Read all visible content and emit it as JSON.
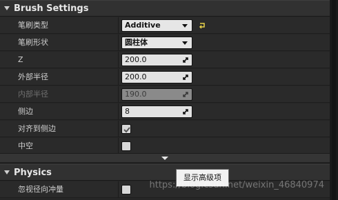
{
  "brush_settings": {
    "title": "Brush Settings",
    "brush_type": {
      "label": "笔刷类型",
      "value": "Additive"
    },
    "brush_shape": {
      "label": "笔刷形状",
      "value": "圆柱体"
    },
    "z": {
      "label": "Z",
      "value": "200.0"
    },
    "outer_radius": {
      "label": "外部半径",
      "value": "200.0"
    },
    "inner_radius": {
      "label": "内部半径",
      "value": "190.0"
    },
    "sides": {
      "label": "侧边",
      "value": "8"
    },
    "align_to_side": {
      "label": "对齐到侧边",
      "checked": true
    },
    "hollow": {
      "label": "中空",
      "checked": false
    }
  },
  "advanced_tooltip": "显示高级项",
  "physics": {
    "title": "Physics",
    "ignore_radial_impulse": {
      "label": "忽视径向冲量",
      "checked": false
    }
  },
  "watermark": "https://blog.csdn.net/weixin_46840974",
  "colors": {
    "panel": "#262626",
    "header": "#313131",
    "reset_accent": "#e8d24a"
  }
}
